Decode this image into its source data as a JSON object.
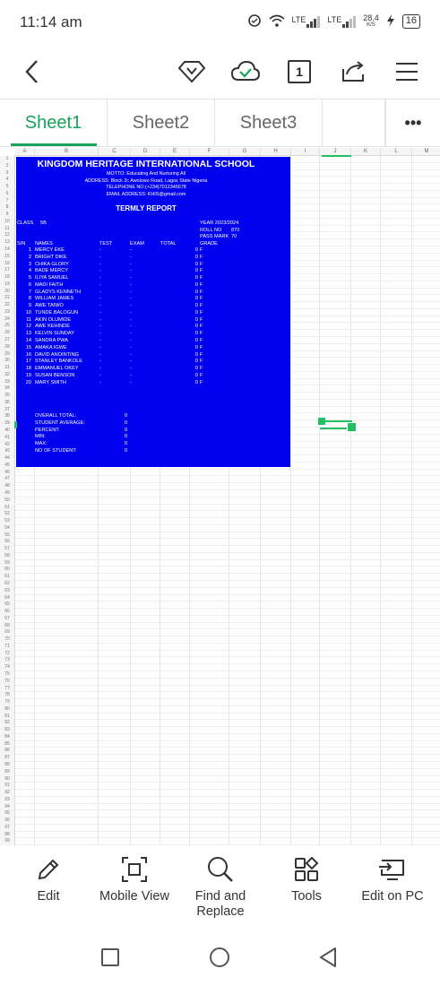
{
  "status_bar": {
    "time": "11:14 am",
    "lte1": "LTE",
    "lte2": "LTE",
    "speed": "28.4",
    "speed_unit": "K/S",
    "battery": "16"
  },
  "toolbar": {
    "sheet_count": "1",
    "icons": [
      "back-icon",
      "diamond-icon",
      "cloud-check-icon",
      "sheet-count-icon",
      "share-icon",
      "menu-icon"
    ]
  },
  "tabs": [
    {
      "label": "Sheet1",
      "active": true
    },
    {
      "label": "Sheet2"
    },
    {
      "label": "Sheet3"
    }
  ],
  "more_label": "•••",
  "grid": {
    "columns": [
      "A",
      "B",
      "C",
      "D",
      "E",
      "F",
      "G",
      "H",
      "I",
      "J",
      "K",
      "L",
      "M"
    ],
    "rows_visible": 100
  },
  "report": {
    "school": "KINGDOM HERITAGE INTERNATIONAL SCHOOL",
    "motto": "MOTTO: Educating And Nurturing All",
    "address": "ADDRESS: Block 2c Awolowo Road, Lagos State Nigeria",
    "telephone": "TELEPHONE NO:(+234)7012345678",
    "email": "EMAIL ADDRESS: KHIS@gmail.com",
    "report_title": "TERMLY REPORT",
    "class_label": "CLASS",
    "class_value": "5B",
    "year": "YEAR 2023/2024",
    "roll_no_label": "ROLL NO",
    "roll_no_value": "870",
    "pass_mark_label": "PASS MARK",
    "pass_mark_value": "70",
    "headers": {
      "sn": "S/N",
      "names": "NAMES",
      "test": "TEST",
      "exam": "EXAM",
      "total": "TOTAL",
      "grade": "GRADE"
    },
    "students": [
      {
        "sn": "1",
        "name": "MERCY EKE",
        "test": "-",
        "exam": "-",
        "total": "0",
        "grade": "F"
      },
      {
        "sn": "2",
        "name": "BRIGHT DIKE",
        "test": "-",
        "exam": "-",
        "total": "0",
        "grade": "F"
      },
      {
        "sn": "3",
        "name": "CHIKA GLORY",
        "test": "-",
        "exam": "-",
        "total": "0",
        "grade": "F"
      },
      {
        "sn": "4",
        "name": "BADE MERCY",
        "test": "-",
        "exam": "-",
        "total": "0",
        "grade": "F"
      },
      {
        "sn": "5",
        "name": "ILIYA SAMUEL",
        "test": "-",
        "exam": "-",
        "total": "0",
        "grade": "F"
      },
      {
        "sn": "6",
        "name": "MADI FAITH",
        "test": "-",
        "exam": "-",
        "total": "0",
        "grade": "F"
      },
      {
        "sn": "7",
        "name": "GLADYS KENNETH",
        "test": "-",
        "exam": "-",
        "total": "0",
        "grade": "F"
      },
      {
        "sn": "8",
        "name": "WILLIAM JAMES",
        "test": "-",
        "exam": "-",
        "total": "0",
        "grade": "F"
      },
      {
        "sn": "9",
        "name": "AWE TAIWO",
        "test": "-",
        "exam": "-",
        "total": "0",
        "grade": "F"
      },
      {
        "sn": "10",
        "name": "TUNDE BALOGUN",
        "test": "-",
        "exam": "-",
        "total": "0",
        "grade": "F"
      },
      {
        "sn": "11",
        "name": "AKIN OLUMIDE",
        "test": "-",
        "exam": "-",
        "total": "0",
        "grade": "F"
      },
      {
        "sn": "12",
        "name": "AWE KEHINDE",
        "test": "-",
        "exam": "-",
        "total": "0",
        "grade": "F"
      },
      {
        "sn": "13",
        "name": "KELVIN SUNDAY",
        "test": "-",
        "exam": "-",
        "total": "0",
        "grade": "F"
      },
      {
        "sn": "14",
        "name": "SANDRA PWA",
        "test": "-",
        "exam": "-",
        "total": "0",
        "grade": "F"
      },
      {
        "sn": "15",
        "name": "AMAKA IGWE",
        "test": "-",
        "exam": "-",
        "total": "0",
        "grade": "F"
      },
      {
        "sn": "16",
        "name": "DAVID ANOINTING",
        "test": "-",
        "exam": "-",
        "total": "0",
        "grade": "F"
      },
      {
        "sn": "17",
        "name": "STANLEY BANKOLE",
        "test": "-",
        "exam": "-",
        "total": "0",
        "grade": "F"
      },
      {
        "sn": "18",
        "name": "EMMANUEL OKEY",
        "test": "-",
        "exam": "-",
        "total": "0",
        "grade": "F"
      },
      {
        "sn": "19",
        "name": "SUSAN BENSON",
        "test": "-",
        "exam": "-",
        "total": "0",
        "grade": "F"
      },
      {
        "sn": "20",
        "name": "MARY SMITH",
        "test": "-",
        "exam": "-",
        "total": "0",
        "grade": "F"
      }
    ],
    "summary": [
      {
        "label": "OVERALL TOTAL:",
        "value": "0"
      },
      {
        "label": "STUDENT AVERAGE:",
        "value": "0"
      },
      {
        "label": "PERCENT:",
        "value": "0"
      },
      {
        "label": "MIN:",
        "value": "0"
      },
      {
        "label": "MAX:",
        "value": "0"
      },
      {
        "label": "NO OF STUDENT:",
        "value": "0"
      }
    ]
  },
  "bottom_bar": [
    {
      "label": "Edit",
      "icon": "pencil-icon"
    },
    {
      "label": "Mobile View",
      "icon": "mobile-view-icon"
    },
    {
      "label": "Find and\nReplace",
      "icon": "search-icon"
    },
    {
      "label": "Tools",
      "icon": "tools-icon"
    },
    {
      "label": "Edit on PC",
      "icon": "monitor-icon"
    }
  ],
  "colors": {
    "accent": "#1aa35a",
    "report_bg": "#0000ee"
  }
}
